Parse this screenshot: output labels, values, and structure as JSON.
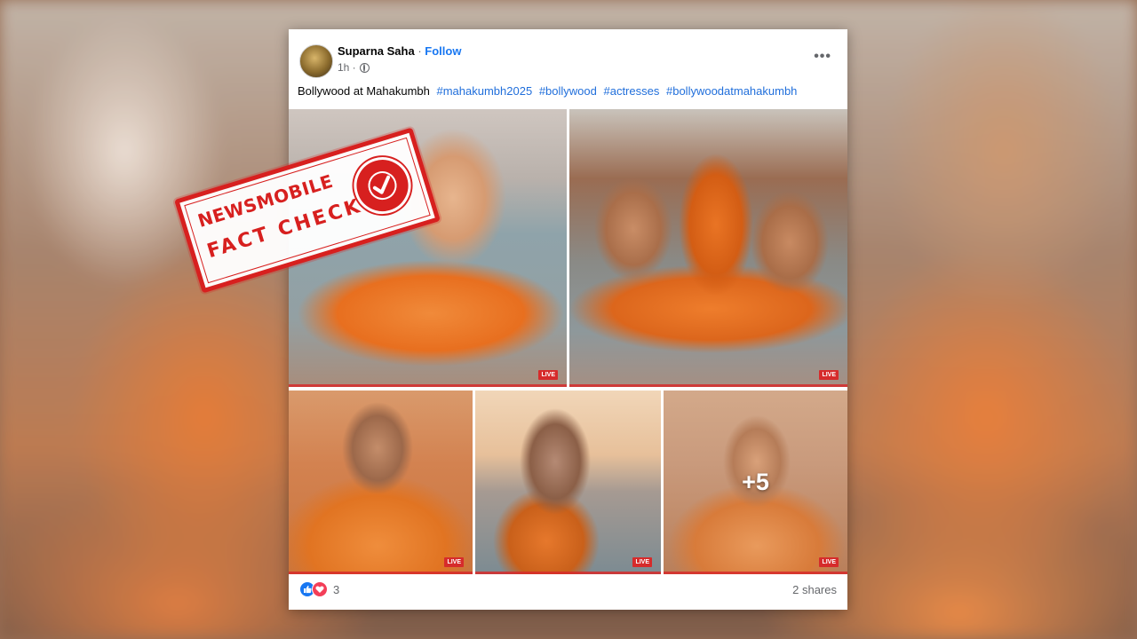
{
  "post": {
    "author": "Suparna Saha",
    "separator": "·",
    "follow_label": "Follow",
    "timestamp": "1h ·",
    "more_label": "•••",
    "caption_text": "Bollywood at Mahakumbh",
    "hashtags": [
      "#mahakumbh2025",
      "#bollywood",
      "#actresses",
      "#bollywoodatmahakumbh"
    ],
    "photos": [
      {
        "badge": "LIVE"
      },
      {
        "badge": "LIVE"
      },
      {
        "badge": "LIVE"
      },
      {
        "badge": "LIVE"
      },
      {
        "badge": "LIVE"
      }
    ],
    "more_photos_label": "+5",
    "reaction_count": "3",
    "shares_label": "2 shares"
  },
  "stamp": {
    "line1": "NEWSMOBILE",
    "line2": "FACT CHECK",
    "color": "#d7201f"
  },
  "colors": {
    "link": "#1877f2",
    "hashtag": "#216fdb",
    "like": "#1877f2",
    "love": "#f33e58"
  }
}
